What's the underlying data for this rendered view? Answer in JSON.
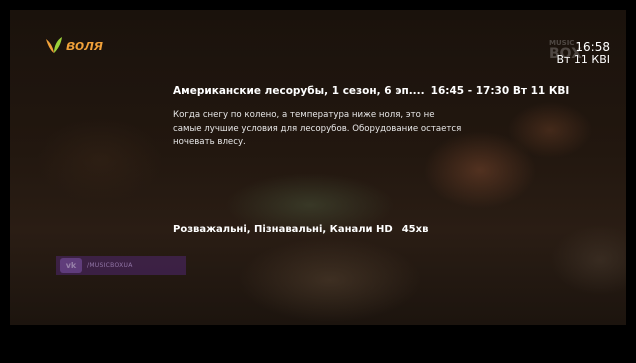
{
  "brand": {
    "logo_text": "воля",
    "logo_color": "#f2a23a"
  },
  "watermark": {
    "top": "MUSIC",
    "bottom": "BOX"
  },
  "clock": {
    "time": "16:58",
    "date": "Вт 11 КВІ"
  },
  "program": {
    "title": "Американские лесорубы, 1 сезон, 6 эп....",
    "time_range": "16:45 - 17:30 Вт 11 КВІ",
    "description": "Когда снегу по колено, а температура ниже ноля, это не самые лучшие условия для лесорубов. Оборудование остается ночевать влесу.",
    "genres": "Розважальні, Пізнавальні, Канали HD",
    "duration": "45хв"
  },
  "social_badge": {
    "icon": "vk-icon",
    "handle": "/MUSICBOXUA"
  }
}
